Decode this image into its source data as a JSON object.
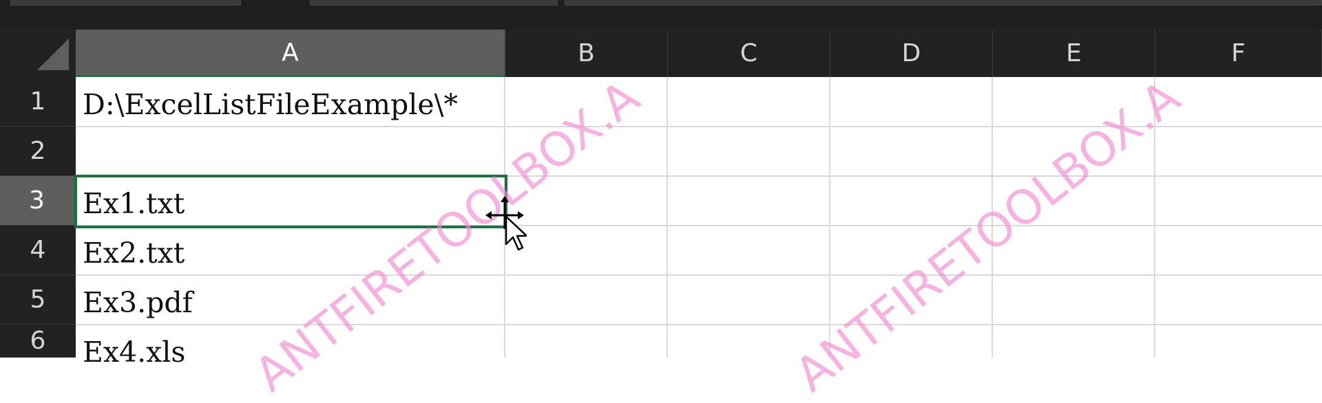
{
  "toolbar": {
    "segments": [
      "",
      "",
      ""
    ]
  },
  "columns": [
    "A",
    "B",
    "C",
    "D",
    "E",
    "F"
  ],
  "rows": [
    "1",
    "2",
    "3",
    "4",
    "5",
    "6"
  ],
  "cells": {
    "A1": "D:\\ExcelListFileExample\\*",
    "A2": "",
    "A3": "Ex1.txt",
    "A4": "Ex2.txt",
    "A5": "Ex3.pdf",
    "A6": "Ex4.xls"
  },
  "selection": {
    "active_cell": "A3",
    "selected_column": "A",
    "selected_row": "3"
  },
  "watermark": {
    "text1": "ANTFIRETOOLBOX.A",
    "text2": "ANTFIRETOOLBOX.A"
  },
  "colors": {
    "selection_border": "#1e7145",
    "header_bg": "#222222",
    "selected_header_bg": "#5e5e5e",
    "gridline": "#d9d9d9",
    "watermark": "#f28bd0"
  }
}
